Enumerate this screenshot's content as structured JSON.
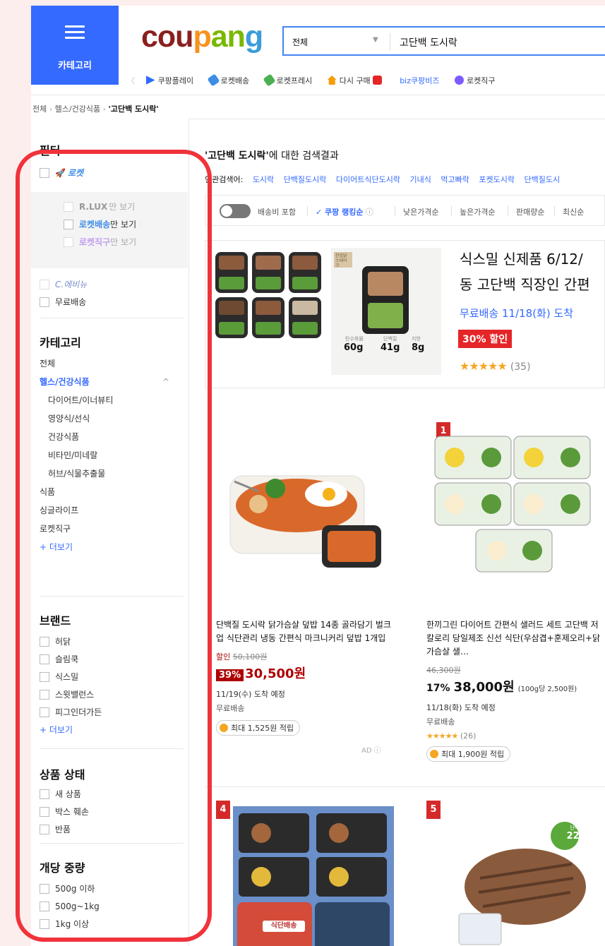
{
  "header": {
    "category_label": "카테고리",
    "logo": {
      "c": "cou",
      "p": "p",
      "a": "an",
      "g": "g"
    },
    "search": {
      "scope": "전체",
      "query": "고단백 도시락"
    },
    "nav_items": [
      "쿠팡플레이",
      "로켓배송",
      "로켓프레시",
      "다시 구매",
      "biz쿠팡비즈",
      "로켓직구"
    ]
  },
  "breadcrumb": {
    "a": "전체",
    "b": "헬스/건강식품",
    "c": "'고단백 도시락'"
  },
  "sidebar": {
    "filter_title": "필터",
    "rocket": "로켓",
    "rlux": {
      "brand": "R.LUX",
      "suffix": "만 보기"
    },
    "rocket_delivery": {
      "brand": "로켓배송",
      "suffix": "만 보기"
    },
    "rocket_direct": {
      "brand": "로켓직구",
      "suffix": "만 보기"
    },
    "c_avenue": "C.에비뉴",
    "free_shipping": "무료배송",
    "category_title": "카테고리",
    "categories": {
      "all": "전체",
      "health": "헬스/건강식품",
      "diet": "다이어트/이너뷰티",
      "nutrition": "영양식/선식",
      "healthfood": "건강식품",
      "vitamin": "비타민/미네랄",
      "herb": "허브/식물추출물",
      "food": "식품",
      "single": "싱글라이프",
      "direct": "로켓직구",
      "more": "+ 더보기"
    },
    "brand_title": "브랜드",
    "brands": [
      "허닭",
      "슬림쿡",
      "식스밀",
      "스윗밸런스",
      "피그인더가든"
    ],
    "brand_more": "+ 더보기",
    "condition_title": "상품 상태",
    "conditions": [
      "새 상품",
      "박스 훼손",
      "반품"
    ],
    "weight_title": "개당 중량",
    "weights": [
      "500g 이하",
      "500g~1kg",
      "1kg 이상"
    ]
  },
  "results": {
    "query": "'고단백 도시락'",
    "suffix": "에 대한 검색결과",
    "related_label": "연관검색어:",
    "related": [
      "도시락",
      "단백질도시락",
      "다이어트식단도시락",
      "기내식",
      "먹고빠락",
      "포켓도시락",
      "단백질도시"
    ]
  },
  "sort": {
    "shipping": "배송비 포함",
    "ranking": "쿠팡 랭킹순",
    "low": "낮은가격순",
    "high": "높은가격순",
    "sales": "판매량순",
    "newest": "최신순"
  },
  "ad": {
    "name1": "식스밀 신제품 6/12/",
    "name2": "동 고단백 직장인 간편",
    "shipping": "무료배송 11/18(화) 도착",
    "discount": "30% 할인",
    "stars": "★★★★★",
    "reviews": "(35)",
    "tag": "한입닭 스테이크",
    "nutrition": [
      {
        "label": "탄수화물",
        "value": "60g"
      },
      {
        "label": "단백질",
        "value": "41g"
      },
      {
        "label": "지방",
        "value": "8g"
      }
    ]
  },
  "products": [
    {
      "name": "단백질 도시락 닭가슴살 덮밥 14종 골라담기 벌크업 식단관리 냉동 간편식 마크니커리 덮밥 1개입",
      "sale_label": "할인",
      "orig": "50,100원",
      "pct": "39%",
      "price": "30,500원",
      "arrival": "11/19(수) 도착 예정",
      "shipping": "무료배송",
      "points": "최대 1,525원 적립",
      "ad": "AD ⓘ"
    },
    {
      "rank": "1",
      "name": "한끼그린 다이어트 간편식 샐러드 세트 고단백 저칼로리 당일제조 신선 식단(우삼겹+훈제오리+닭가슴살 샐…",
      "orig": "46,300원",
      "pct": "17%",
      "price": "38,000원",
      "unit": "(100g당 2,500원)",
      "arrival": "11/18(화) 도착 예정",
      "shipping": "무료배송",
      "stars": "★★★★★",
      "reviews": "(26)",
      "points": "최대 1,900원 적립"
    },
    {
      "rank": "4",
      "label": "식단배송"
    },
    {
      "rank": "5",
      "badge_a": "단백질",
      "badge_b": "22G"
    }
  ],
  "colors": {
    "accent": "#346aff",
    "sale": "#ae0000",
    "highlight": "#f0333b",
    "star": "#f5a623"
  }
}
